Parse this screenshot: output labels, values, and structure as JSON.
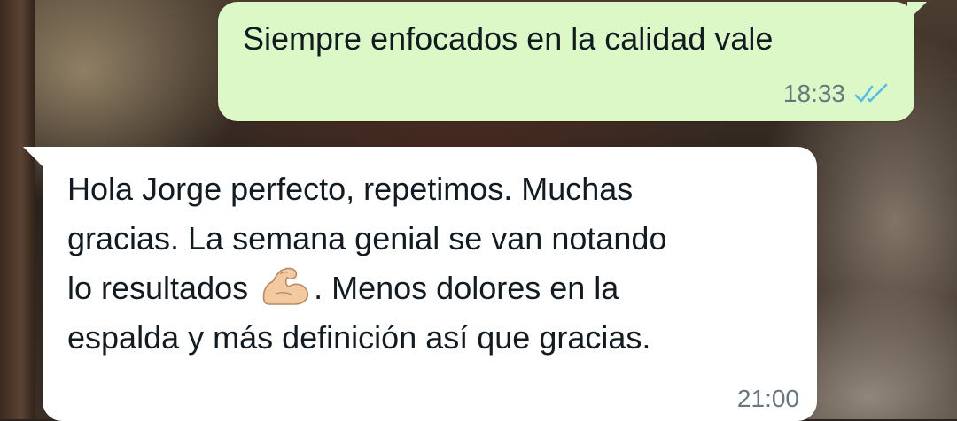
{
  "messages": [
    {
      "direction": "outgoing",
      "text": "Siempre enfocados en la calidad vale",
      "time": "18:33",
      "status": "read",
      "status_icon": "double-check-icon",
      "status_color": "#53bdeb",
      "bubble_color": "#dcf8c6"
    },
    {
      "direction": "incoming",
      "text_line1": "Hola Jorge perfecto, repetimos. Muchas",
      "text_line2": "gracias. La semana genial se van notando",
      "text_line3_before_emoji": "lo resultados ",
      "emoji": "flexed-biceps-icon",
      "text_line3_after_emoji": ". Menos dolores en la",
      "text_line4": "espalda y más definición así que gracias.",
      "time": "21:00",
      "bubble_color": "#ffffff"
    }
  ]
}
